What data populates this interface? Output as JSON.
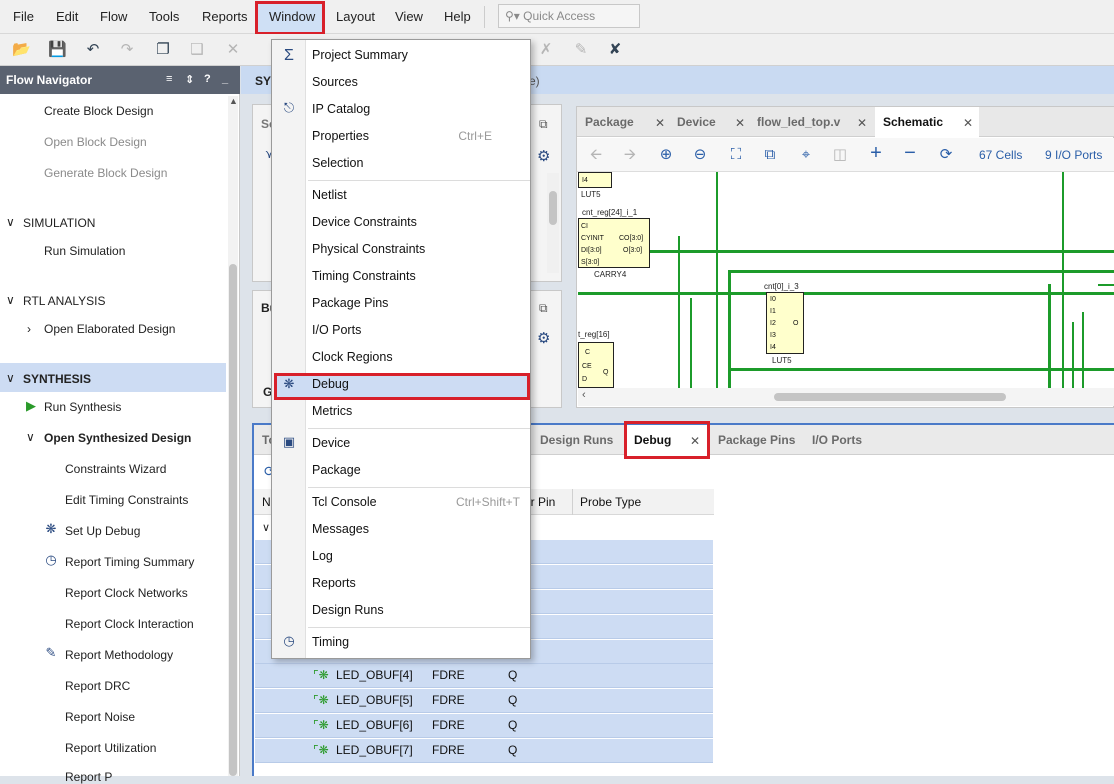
{
  "menubar": {
    "items": [
      {
        "label": "File",
        "ul": "F",
        "rest": "ile"
      },
      {
        "label": "Edit",
        "ul": "E",
        "rest": "dit"
      },
      {
        "label": "Flow",
        "ul": "",
        "rest": "Flow"
      },
      {
        "label": "Tools",
        "ul": "T",
        "rest": "ools"
      },
      {
        "label": "Reports",
        "ul": "",
        "rest": "Reports"
      },
      {
        "label": "Window",
        "ul": "W",
        "rest": "indow"
      },
      {
        "label": "Layout",
        "ul": "",
        "rest": "Layout"
      },
      {
        "label": "View",
        "ul": "V",
        "rest": "iew"
      },
      {
        "label": "Help",
        "ul": "H",
        "rest": "elp"
      }
    ],
    "quick_access_placeholder": "Quick Access"
  },
  "nav": {
    "title": "Flow Navigator",
    "items": [
      {
        "label": "Create Block Design",
        "state": "enabled"
      },
      {
        "label": "Open Block Design",
        "state": "disabled"
      },
      {
        "label": "Generate Block Design",
        "state": "disabled"
      },
      {
        "label": "SIMULATION",
        "state": "section"
      },
      {
        "label": "Run Simulation",
        "state": "enabled"
      },
      {
        "label": "RTL ANALYSIS",
        "state": "section"
      },
      {
        "label": "Open Elaborated Design",
        "state": "enabled"
      },
      {
        "label": "SYNTHESIS",
        "state": "section"
      },
      {
        "label": "Run Synthesis",
        "state": "enabled"
      },
      {
        "label": "Open Synthesized Design",
        "state": "bold"
      },
      {
        "label": "Constraints Wizard",
        "state": "enabled"
      },
      {
        "label": "Edit Timing Constraints",
        "state": "enabled"
      },
      {
        "label": "Set Up Debug",
        "state": "enabled"
      },
      {
        "label": "Report Timing Summary",
        "state": "enabled"
      },
      {
        "label": "Report Clock Networks",
        "state": "enabled"
      },
      {
        "label": "Report Clock Interaction",
        "state": "enabled"
      },
      {
        "label": "Report Methodology",
        "state": "enabled"
      },
      {
        "label": "Report DRC",
        "state": "enabled"
      },
      {
        "label": "Report Noise",
        "state": "enabled"
      },
      {
        "label": "Report Utilization",
        "state": "enabled"
      },
      {
        "label": "Report P",
        "state": "enabled"
      }
    ]
  },
  "main": {
    "header": "SYN",
    "header_tail": "e)",
    "left_pane1_tab": "So",
    "left_pane2_tab": "Bu",
    "left_pane2_letter": "G"
  },
  "schematic_panel": {
    "tabs": [
      {
        "label": "Package",
        "active": false
      },
      {
        "label": "Device",
        "active": false
      },
      {
        "label": "flow_led_top.v",
        "active": false
      },
      {
        "label": "Schematic",
        "active": true
      }
    ],
    "cells_count": "67 Cells",
    "ports_count": "9 I/O Ports",
    "cells": {
      "lut5_top": "LUT5",
      "carry": "cnt_reg[24]_i_1",
      "carry_pins_left": [
        "CI",
        "CYINIT",
        "DI[3:0]",
        "S[3:0]"
      ],
      "carry_pins_right": [
        "CO[3:0]",
        "O[3:0]"
      ],
      "carry_type": "CARRY4",
      "lut": "cnt[0]_i_3",
      "lut_pins": [
        "I0",
        "I1",
        "I2",
        "I3",
        "I4"
      ],
      "lut_out": "O",
      "lut_type": "LUT5",
      "ff": "t_reg[16]",
      "ff_pins": [
        "C",
        "CE",
        "D"
      ],
      "ff_out": "Q",
      "i4": "I4"
    }
  },
  "bottom_panel": {
    "tabs": [
      {
        "label": "To",
        "active": false
      },
      {
        "label": "Design Runs",
        "active": false
      },
      {
        "label": "Debug",
        "active": true
      },
      {
        "label": "Package Pins",
        "active": false
      },
      {
        "label": "I/O Ports",
        "active": false
      }
    ],
    "columns": [
      "N",
      "er Pin",
      "Probe Type"
    ],
    "rows": [
      {
        "name": "LED_OBUF[4]",
        "type": "FDRE",
        "pin": "Q"
      },
      {
        "name": "LED_OBUF[5]",
        "type": "FDRE",
        "pin": "Q"
      },
      {
        "name": "LED_OBUF[6]",
        "type": "FDRE",
        "pin": "Q"
      },
      {
        "name": "LED_OBUF[7]",
        "type": "FDRE",
        "pin": "Q"
      }
    ]
  },
  "window_menu": {
    "items": [
      {
        "label": "Project Summary",
        "shortcut": "",
        "icon": "sigma-icon"
      },
      {
        "label": "Sources",
        "shortcut": "",
        "icon": ""
      },
      {
        "label": "IP Catalog",
        "shortcut": "",
        "icon": "ip-icon"
      },
      {
        "label": "Properties",
        "shortcut": "Ctrl+E",
        "icon": ""
      },
      {
        "label": "Selection",
        "shortcut": "",
        "icon": ""
      },
      {
        "label": "Netlist",
        "shortcut": "",
        "icon": ""
      },
      {
        "label": "Device Constraints",
        "shortcut": "",
        "icon": ""
      },
      {
        "label": "Physical Constraints",
        "shortcut": "",
        "icon": ""
      },
      {
        "label": "Timing Constraints",
        "shortcut": "",
        "icon": ""
      },
      {
        "label": "Package Pins",
        "shortcut": "",
        "icon": ""
      },
      {
        "label": "I/O Ports",
        "shortcut": "",
        "icon": ""
      },
      {
        "label": "Clock Regions",
        "shortcut": "",
        "icon": ""
      },
      {
        "label": "Debug",
        "shortcut": "",
        "icon": "bug-icon"
      },
      {
        "label": "Metrics",
        "shortcut": "",
        "icon": ""
      },
      {
        "label": "Device",
        "shortcut": "",
        "icon": "chip-icon"
      },
      {
        "label": "Package",
        "shortcut": "",
        "icon": ""
      },
      {
        "label": "Tcl Console",
        "shortcut": "Ctrl+Shift+T",
        "icon": ""
      },
      {
        "label": "Messages",
        "shortcut": "",
        "icon": ""
      },
      {
        "label": "Log",
        "shortcut": "",
        "icon": ""
      },
      {
        "label": "Reports",
        "shortcut": "",
        "icon": ""
      },
      {
        "label": "Design Runs",
        "shortcut": "",
        "icon": ""
      },
      {
        "label": "Timing",
        "shortcut": "",
        "icon": "clock-icon"
      }
    ]
  }
}
